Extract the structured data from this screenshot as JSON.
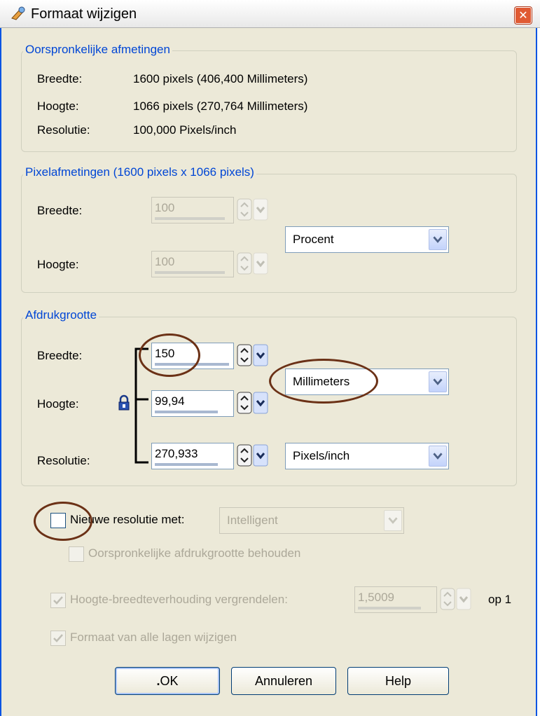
{
  "dialog": {
    "title": "Formaat wijzigen",
    "close_icon": "close-icon"
  },
  "original": {
    "legend": "Oorspronkelijke afmetingen",
    "rows": [
      {
        "label": "Breedte:",
        "value": "1600 pixels (406,400 Millimeters)"
      },
      {
        "label": "Hoogte:",
        "value": "1066 pixels (270,764 Millimeters)"
      },
      {
        "label": "Resolutie:",
        "value": "100,000 Pixels/inch"
      }
    ]
  },
  "pixel": {
    "legend": "Pixelafmetingen (1600 pixels x 1066 pixels)",
    "width_label": "Breedte:",
    "width_value": "100",
    "height_label": "Hoogte:",
    "height_value": "100",
    "unit": "Procent"
  },
  "print": {
    "legend": "Afdrukgrootte",
    "width_label": "Breedte:",
    "width_value": "150",
    "height_label": "Hoogte:",
    "height_value": "99,94",
    "resolution_label": "Resolutie:",
    "resolution_value": "270,933",
    "size_unit": "Millimeters",
    "resolution_unit": "Pixels/inch",
    "lock_icon": "lock-icon"
  },
  "options": {
    "resample_label": "Nieuwe resolutie met:",
    "resample_checked": false,
    "resample_method": "Intelligent",
    "keep_print_size_label": "Oorspronkelijke afdrukgrootte behouden",
    "lock_aspect_label": "Hoogte-breedteverhouding vergrendelen:",
    "lock_aspect_checked": true,
    "aspect_value": "1,5009",
    "aspect_suffix": "op 1",
    "resize_layers_label": "Formaat van alle lagen wijzigen",
    "resize_layers_checked": true
  },
  "buttons": {
    "ok": "OK",
    "cancel": "Annuleren",
    "help": "Help"
  },
  "colors": {
    "legend": "#0046d5",
    "annotation": "#6b3116"
  }
}
